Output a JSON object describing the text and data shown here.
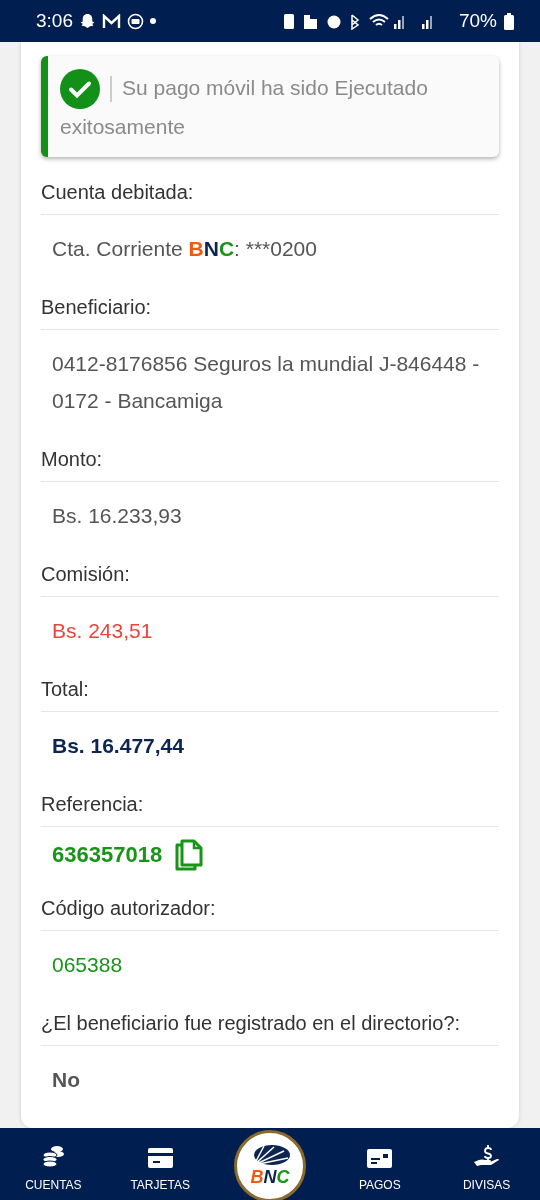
{
  "status_bar": {
    "time": "3:06",
    "battery": "70%"
  },
  "alert": {
    "message": "Su pago móvil ha sido Ejecutado exitosamente"
  },
  "fields": [
    {
      "label": "Cuenta debitada:",
      "kind": "account",
      "prefix": "Cta. Corriente ",
      "brand": "BNC",
      "suffix": ": ***0200"
    },
    {
      "label": "Beneficiario:",
      "kind": "plain",
      "value": "0412-8176856 Seguros la mundial J-846448 - 0172 - Bancamiga"
    },
    {
      "label": "Monto:",
      "kind": "plain",
      "value": "Bs. 16.233,93"
    },
    {
      "label": "Comisión:",
      "kind": "fee",
      "value": "Bs. 243,51"
    },
    {
      "label": "Total:",
      "kind": "total",
      "value": "Bs. 16.477,44"
    },
    {
      "label": "Referencia:",
      "kind": "reference",
      "value": "636357018"
    },
    {
      "label": "Código autorizador:",
      "kind": "code",
      "value": "065388"
    },
    {
      "label": "¿El beneficiario fue registrado en el directorio?:",
      "kind": "answer",
      "value": "No"
    }
  ],
  "nav": [
    {
      "label": "CUENTAS",
      "kind": "coins"
    },
    {
      "label": "TARJETAS",
      "kind": "card"
    },
    {
      "label": "BNC",
      "kind": "logo"
    },
    {
      "label": "PAGOS",
      "kind": "bill"
    },
    {
      "label": "DIVISAS",
      "kind": "hand"
    }
  ]
}
